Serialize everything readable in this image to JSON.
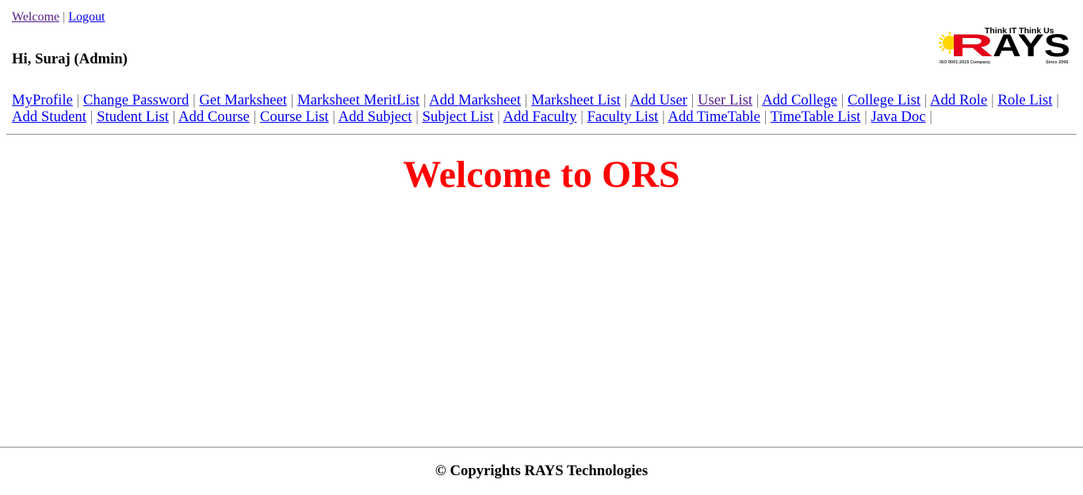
{
  "header": {
    "welcome_link": "Welcome",
    "logout_link": "Logout",
    "separator": "|",
    "greeting": "Hi, Suraj (Admin)"
  },
  "logo": {
    "brand": "RAYS",
    "tagline": "Think IT Think Us",
    "iso": "ISO 9001:2015 Company",
    "since": "Since 2006",
    "brand_color": "#e2001a",
    "sun_color": "#ffd400"
  },
  "nav": {
    "separator": "|",
    "items": [
      {
        "label": "MyProfile"
      },
      {
        "label": "Change Password"
      },
      {
        "label": "Get Marksheet"
      },
      {
        "label": "Marksheet MeritList"
      },
      {
        "label": "Add Marksheet"
      },
      {
        "label": "Marksheet List"
      },
      {
        "label": "Add User"
      },
      {
        "label": "User List",
        "visited": true
      },
      {
        "label": "Add College"
      },
      {
        "label": "College List"
      },
      {
        "label": "Add Role"
      },
      {
        "label": "Role List"
      },
      {
        "label": "Add Student"
      },
      {
        "label": "Student List"
      },
      {
        "label": "Add Course"
      },
      {
        "label": "Course List"
      },
      {
        "label": "Add Subject"
      },
      {
        "label": "Subject List"
      },
      {
        "label": "Add Faculty"
      },
      {
        "label": "Faculty List"
      },
      {
        "label": "Add TimeTable"
      },
      {
        "label": "TimeTable List"
      },
      {
        "label": "Java Doc"
      }
    ]
  },
  "main": {
    "heading": "Welcome to ORS",
    "heading_color": "#ff0000"
  },
  "footer": {
    "text": "© Copyrights RAYS Technologies"
  }
}
